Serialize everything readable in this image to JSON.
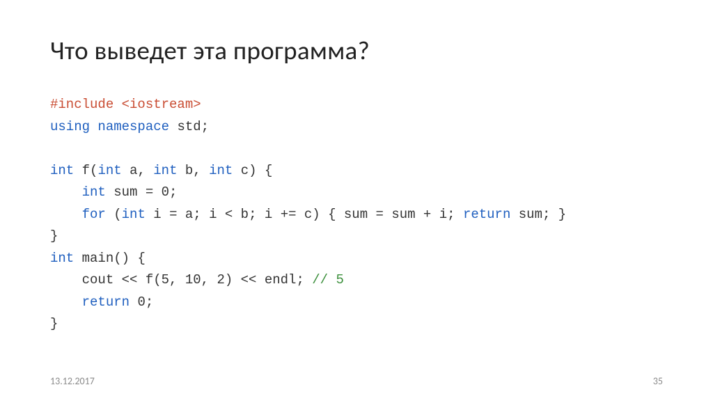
{
  "slide": {
    "title": "Что выведет эта программа?",
    "code": {
      "l1_include": "#include <iostream>",
      "l2_using": "using",
      "l2_namespace": "namespace",
      "l2_std": "std;",
      "l4_int": "int",
      "l4_fsig1": "f(",
      "l4_int2": "int",
      "l4_a": "a,",
      "l4_int3": "int",
      "l4_b": "b,",
      "l4_int4": "int",
      "l4_c": "c) {",
      "l5_int": "int",
      "l5_rest": "sum = 0;",
      "l6_for": "for",
      "l6_p1": "(",
      "l6_int": "int",
      "l6_body": "i = a; i < b; i += c) { sum = sum + i;",
      "l6_return": "return",
      "l6_sum": "sum; }",
      "l7": "}",
      "l8_int": "int",
      "l8_main": "main() {",
      "l9_body": "cout << f(5, 10, 2) << endl;",
      "l9_comment": "// 5",
      "l10_return": "return",
      "l10_zero": "0;",
      "l11": "}"
    },
    "date": "13.12.2017",
    "page": "35"
  }
}
